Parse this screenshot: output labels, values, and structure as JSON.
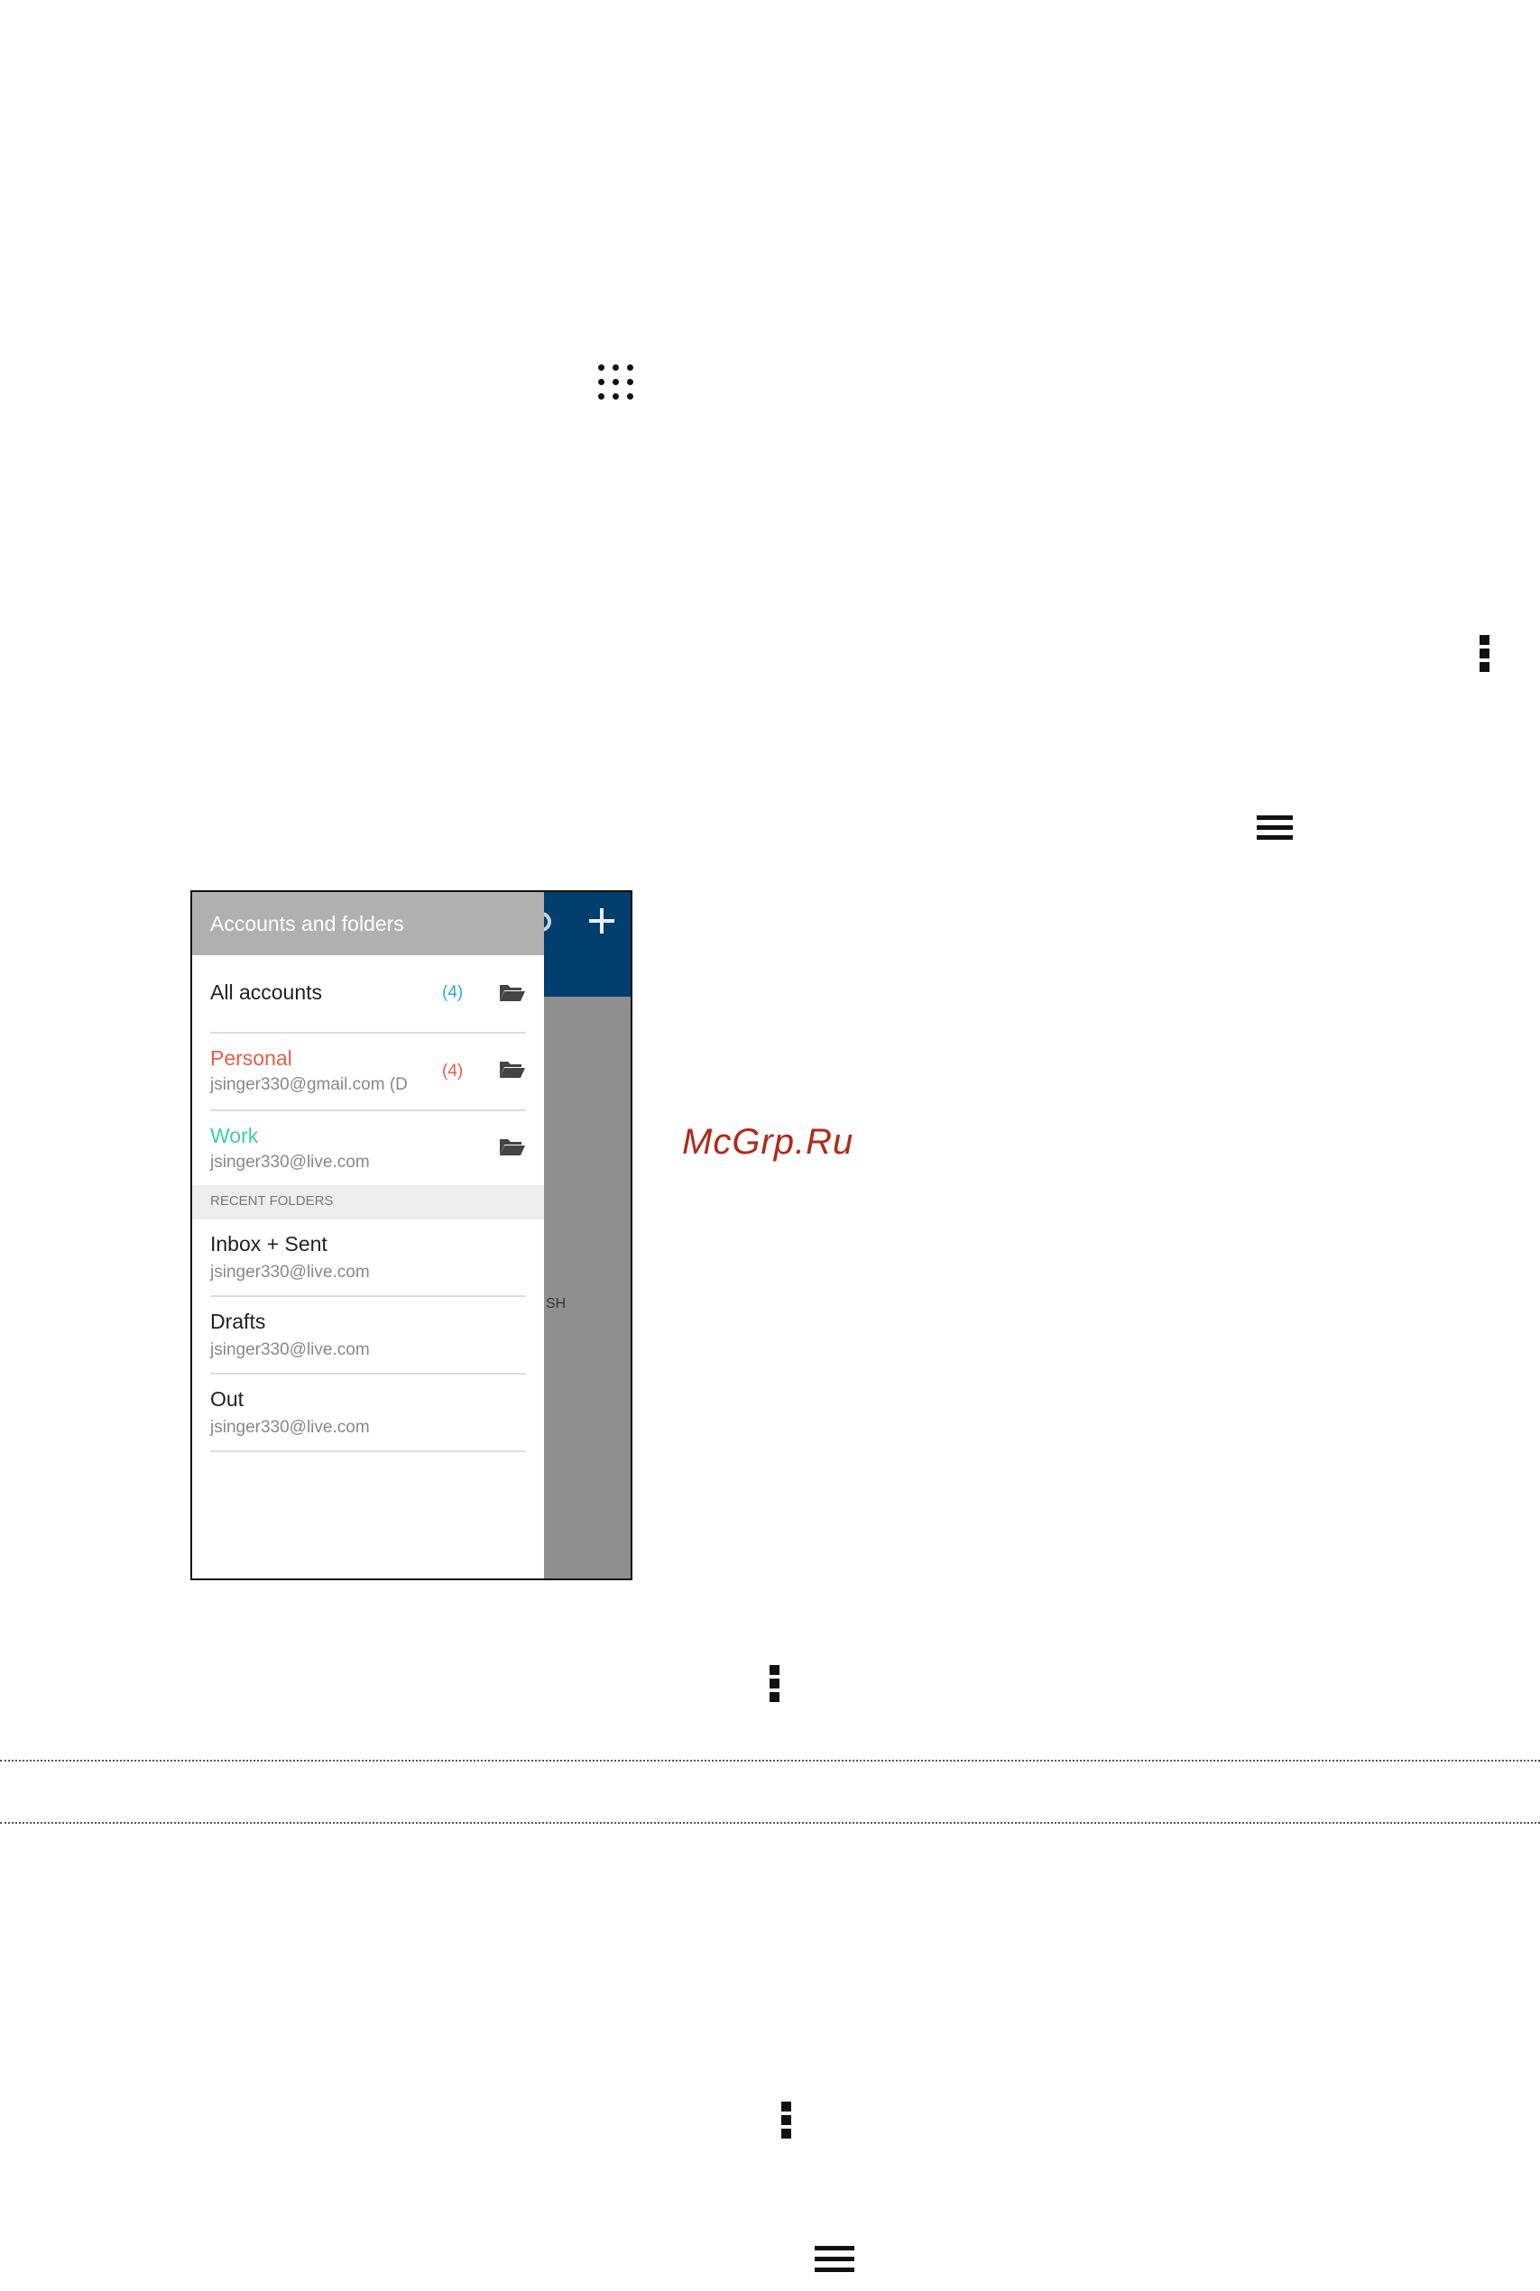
{
  "icons": {
    "apps": "apps-grid-icon",
    "more": "more-vertical-icon",
    "menu": "hamburger-menu-icon",
    "folder": "folder-open-icon",
    "search": "search-icon",
    "add": "plus-icon"
  },
  "colors": {
    "app_bar": "#003e6e",
    "drawer_header": "#b0b0b0",
    "count_blue": "#2aa7e0",
    "personal_red": "#ea5b45",
    "work_green": "#3ccfa4"
  },
  "screenshot": {
    "drawer_title": "Accounts and folders",
    "behind_text": "SH",
    "accounts": [
      {
        "name": "All accounts",
        "email": "",
        "count": "(4)"
      },
      {
        "name": "Personal",
        "email": "jsinger330@gmail.com (D",
        "count": "(4)"
      },
      {
        "name": "Work",
        "email": "jsinger330@live.com",
        "count": ""
      }
    ],
    "recent_label": "RECENT FOLDERS",
    "recent_folders": [
      {
        "name": "Inbox + Sent",
        "email": "jsinger330@live.com"
      },
      {
        "name": "Drafts",
        "email": "jsinger330@live.com"
      },
      {
        "name": "Out",
        "email": "jsinger330@live.com"
      }
    ]
  },
  "watermark": "McGrp.Ru"
}
